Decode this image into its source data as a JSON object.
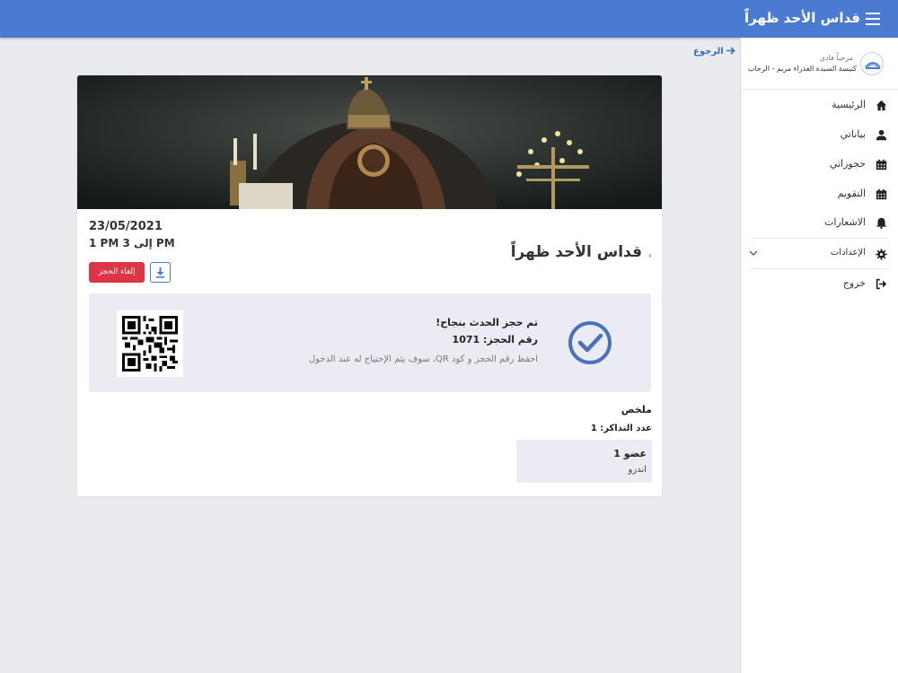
{
  "app": {
    "title": "قداس الأحد ظهراً"
  },
  "sidebar": {
    "greeting": "مرحباً فادي",
    "church": "كنيسة السيدة العذراء مريم - الرحاب",
    "items": [
      {
        "label": "الرئيسية",
        "icon": "home-icon"
      },
      {
        "label": "بياناتي",
        "icon": "user-icon"
      },
      {
        "label": "حجوزاتي",
        "icon": "calendar-icon"
      },
      {
        "label": "التقويم",
        "icon": "calendar-icon"
      },
      {
        "label": "الاشعارات",
        "icon": "bell-icon"
      },
      {
        "label": "الإعدادات",
        "icon": "gear-icon"
      },
      {
        "label": "خروج",
        "icon": "logout-icon"
      }
    ]
  },
  "back": {
    "label": "الرجوع"
  },
  "event": {
    "title": "قداس الأحد ظهراً",
    "date": "23/05/2021",
    "time": "1 PM إلى 3 PM",
    "cancel_label": "إلغاء الحجز"
  },
  "confirmation": {
    "title": "تم حجز الحدث بنجاح!",
    "booking_number": "رقم الحجز: 1071",
    "note": "احفظ رقم الحجز و كود QR، سوف يتم الإحتياج له عند الدخول"
  },
  "summary": {
    "title": "ملخص",
    "tickets": "عدد التذاكر: 1",
    "member_title": "عضو 1",
    "member_name": "اندرو"
  },
  "colors": {
    "primary": "#4a7bd0",
    "danger": "#dc3545",
    "panel": "#ebebf3",
    "check": "#4a72b8"
  }
}
